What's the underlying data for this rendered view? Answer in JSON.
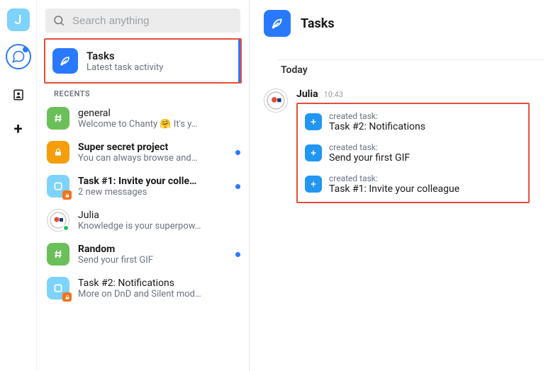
{
  "user_initial": "J",
  "search": {
    "placeholder": "Search anything"
  },
  "tasks_card": {
    "title": "Tasks",
    "subtitle": "Latest task activity"
  },
  "section_recents": "RECENTS",
  "recents": [
    {
      "title": "general",
      "subtitle": "Welcome to Chanty 🤗 It's y…",
      "bold": false,
      "unread": false,
      "icon": "hash-green"
    },
    {
      "title": "Super secret project",
      "subtitle": "You can always browse and…",
      "bold": true,
      "unread": true,
      "icon": "lock-orange"
    },
    {
      "title": "Task #1: Invite your colle…",
      "subtitle": "2 new messages",
      "bold": true,
      "unread": true,
      "icon": "task-blue-lock"
    },
    {
      "title": "Julia",
      "subtitle": "Knowledge is your superpow…",
      "bold": false,
      "unread": false,
      "icon": "avatar-julia"
    },
    {
      "title": "Random",
      "subtitle": "Send your first GIF",
      "bold": true,
      "unread": true,
      "icon": "hash-green"
    },
    {
      "title": "Task #2: Notifications",
      "subtitle": "More on DnD and Silent mod…",
      "bold": false,
      "unread": false,
      "icon": "task-blue-lock"
    }
  ],
  "main": {
    "title": "Tasks",
    "today_label": "Today",
    "sender": "Julia",
    "time": "10:43",
    "created_prefix": "created task:",
    "tasks": [
      {
        "name": "Task #2: Notifications"
      },
      {
        "name": "Send your first GIF"
      },
      {
        "name": "Task #1: Invite your colleague"
      }
    ]
  }
}
